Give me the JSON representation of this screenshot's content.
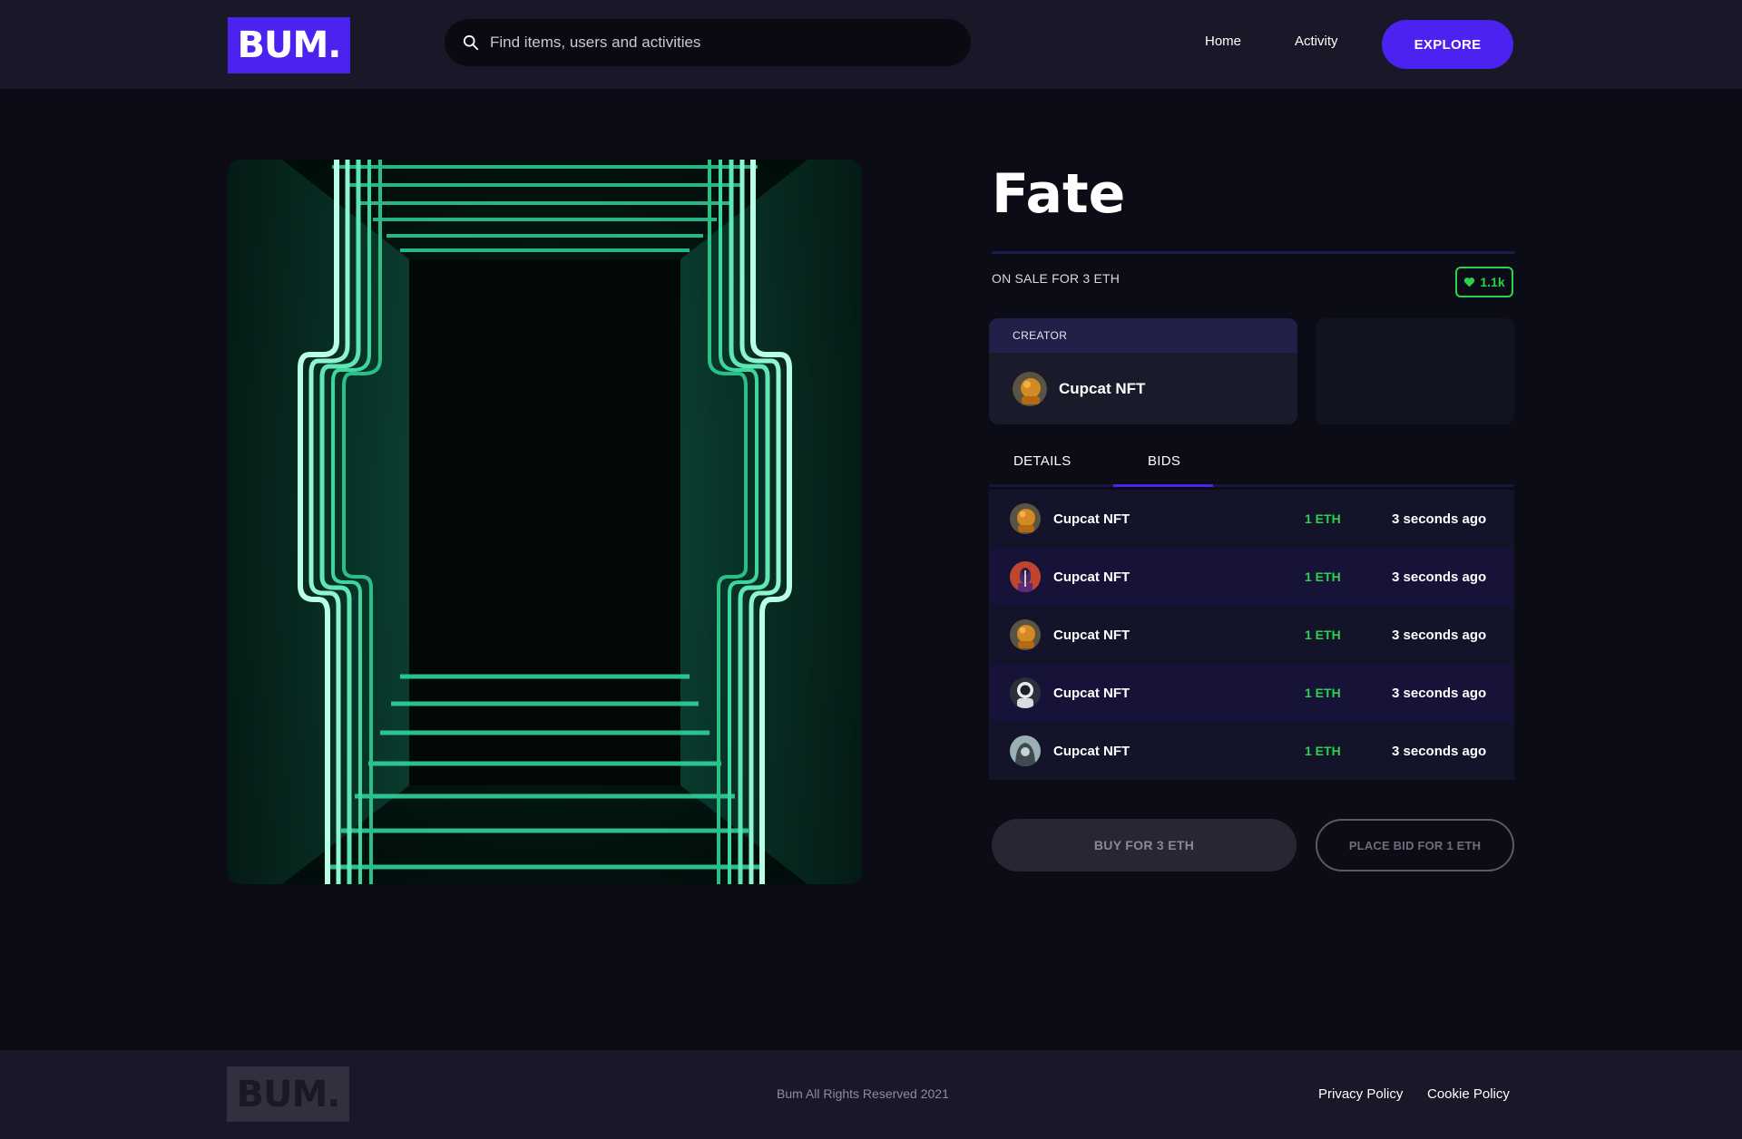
{
  "header": {
    "logo": "BUM.",
    "search_placeholder": "Find items, users and activities",
    "nav": {
      "home": "Home",
      "activity": "Activity"
    },
    "explore_label": "EXPLORE"
  },
  "item": {
    "title": "Fate",
    "sale_text": "ON SALE FOR 3 ETH",
    "likes": "1.1k",
    "creator_label": "CREATOR",
    "creator_name": "Cupcat NFT"
  },
  "tabs": {
    "details": "DETAILS",
    "bids": "BIDS",
    "active": "BIDS"
  },
  "bids": [
    {
      "name": "Cupcat NFT",
      "amount": "1 ETH",
      "time": "3 seconds ago",
      "avatar": "cupcat-avatar"
    },
    {
      "name": "Cupcat NFT",
      "amount": "1 ETH",
      "time": "3 seconds ago",
      "avatar": "ape-avatar"
    },
    {
      "name": "Cupcat NFT",
      "amount": "1 ETH",
      "time": "3 seconds ago",
      "avatar": "cupcat-avatar"
    },
    {
      "name": "Cupcat NFT",
      "amount": "1 ETH",
      "time": "3 seconds ago",
      "avatar": "astronaut-avatar"
    },
    {
      "name": "Cupcat NFT",
      "amount": "1 ETH",
      "time": "3 seconds ago",
      "avatar": "hooded-avatar"
    }
  ],
  "actions": {
    "buy_label": "BUY  FOR 3 ETH",
    "bid_label": "PLACE BID FOR 1 ETH"
  },
  "footer": {
    "logo": "BUM.",
    "copyright": "Bum All Rights Reserved 2021",
    "privacy": "Privacy Policy",
    "cookie": "Cookie Policy"
  },
  "colors": {
    "accent": "#4b22f0",
    "success": "#2bd14a",
    "background": "#0b0c16",
    "header": "#181828"
  }
}
